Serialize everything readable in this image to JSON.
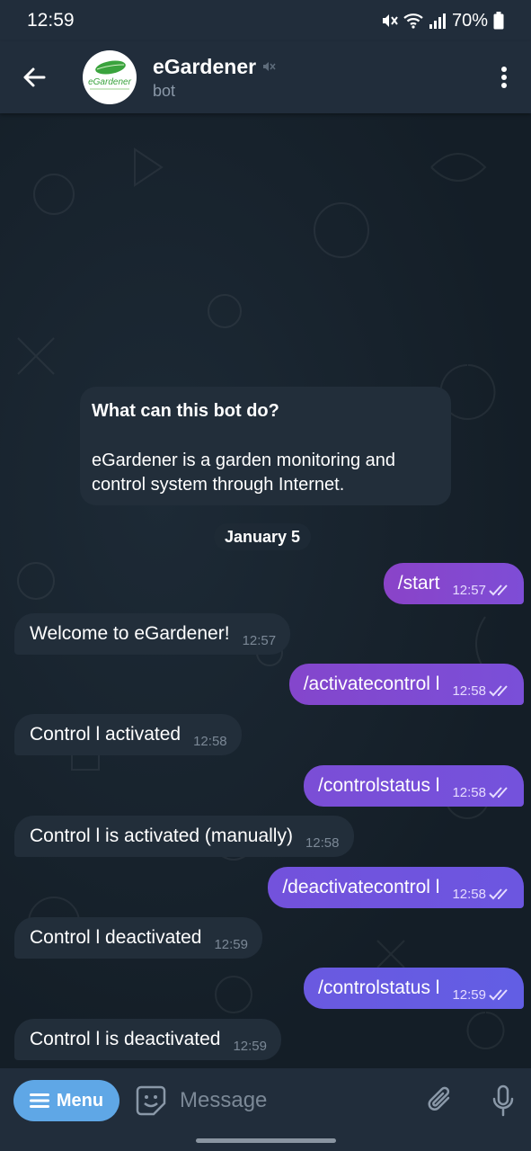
{
  "status_bar": {
    "time": "12:59",
    "battery": "70%"
  },
  "header": {
    "title": "eGardener",
    "subtitle": "bot",
    "avatar_text": "eGardener"
  },
  "bot_info": {
    "title": "What can this bot do?",
    "description": "eGardener is a garden monitoring and control system through Internet."
  },
  "date_label": "January 5",
  "messages": [
    {
      "dir": "out",
      "text": "/start",
      "time": "12:57"
    },
    {
      "dir": "in",
      "text": "Welcome to eGardener!",
      "time": "12:57"
    },
    {
      "dir": "out",
      "text": "/activatecontrol l",
      "time": "12:58"
    },
    {
      "dir": "in",
      "text": "Control l activated",
      "time": "12:58"
    },
    {
      "dir": "out",
      "text": "/controlstatus l",
      "time": "12:58"
    },
    {
      "dir": "in",
      "text": "Control l is activated (manually)",
      "time": "12:58"
    },
    {
      "dir": "out",
      "text": "/deactivatecontrol l",
      "time": "12:58"
    },
    {
      "dir": "in",
      "text": "Control l deactivated",
      "time": "12:59"
    },
    {
      "dir": "out",
      "text": "/controlstatus l",
      "time": "12:59"
    },
    {
      "dir": "in",
      "text": "Control l is deactivated",
      "time": "12:59"
    }
  ],
  "composer": {
    "menu_label": "Menu",
    "placeholder": "Message"
  },
  "colors": {
    "header_bg": "#212d3b",
    "incoming_bubble": "#222e3a",
    "outgoing_bubble_gradient": [
      "#8a43c8",
      "#6a5ae0"
    ],
    "menu_button": "#5fa7e6"
  }
}
